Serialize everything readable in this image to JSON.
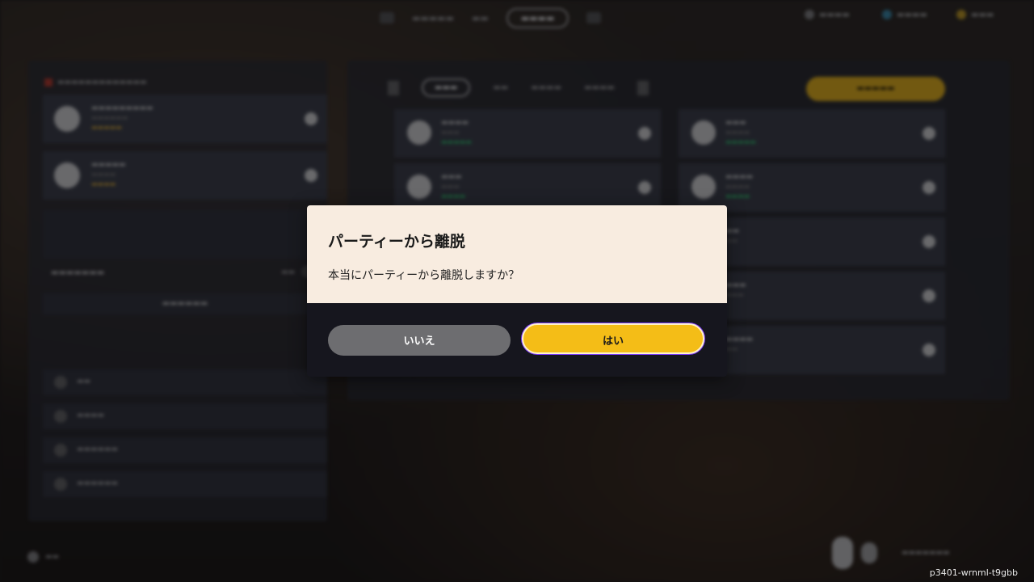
{
  "dialog": {
    "title": "パーティーから離脱",
    "message": "本当にパーティーから離脱しますか？",
    "no_label": "いいえ",
    "yes_label": "はい",
    "yes_color": "#f4bd17",
    "no_color": "#6d6d70"
  },
  "footer": {
    "watermark": "p3401-wrnml-t9gbb"
  }
}
